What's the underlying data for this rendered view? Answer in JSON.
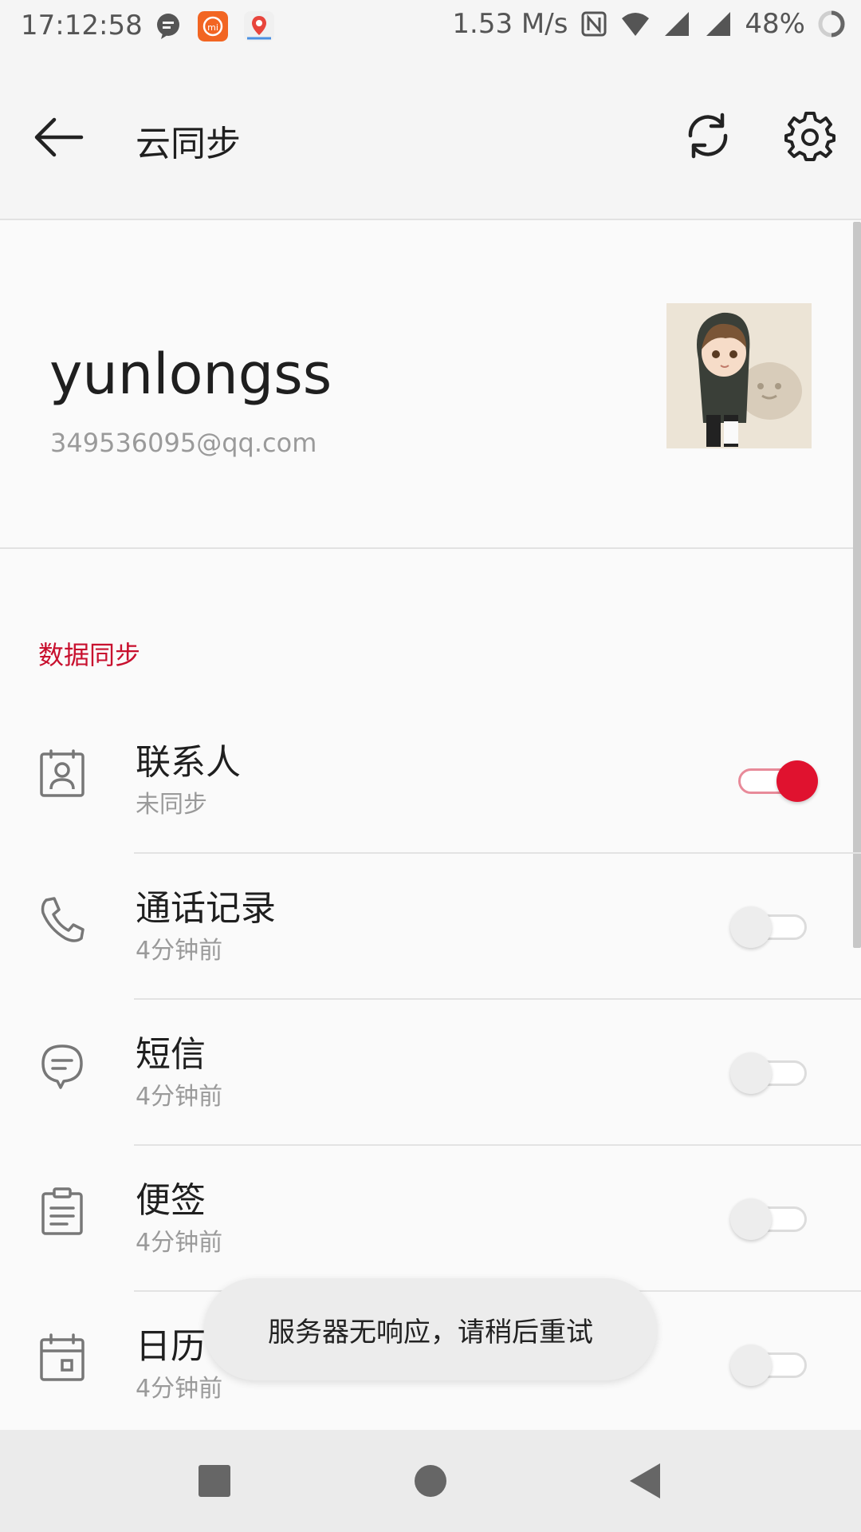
{
  "status_bar": {
    "time": "17:12:58",
    "network_speed": "1.53 M/s",
    "battery": "48%"
  },
  "app_bar": {
    "title": "云同步",
    "back_icon": "arrow-left-icon",
    "sync_icon": "sync-icon",
    "settings_icon": "gear-icon"
  },
  "account": {
    "username": "yunlongss",
    "email": "349536095@qq.com"
  },
  "section": {
    "title": "数据同步"
  },
  "items": [
    {
      "title": "联系人",
      "subtitle": "未同步",
      "icon": "contacts-icon",
      "enabled": true
    },
    {
      "title": "通话记录",
      "subtitle": "4分钟前",
      "icon": "phone-icon",
      "enabled": false
    },
    {
      "title": "短信",
      "subtitle": "4分钟前",
      "icon": "message-icon",
      "enabled": false
    },
    {
      "title": "便签",
      "subtitle": "4分钟前",
      "icon": "note-icon",
      "enabled": false
    },
    {
      "title": "日历",
      "subtitle": "4分钟前",
      "icon": "calendar-icon",
      "enabled": false
    }
  ],
  "toast": {
    "message": "服务器无响应，请稍后重试"
  },
  "colors": {
    "accent": "#e0122f",
    "section_header": "#c8102e",
    "background": "#fafafa"
  }
}
